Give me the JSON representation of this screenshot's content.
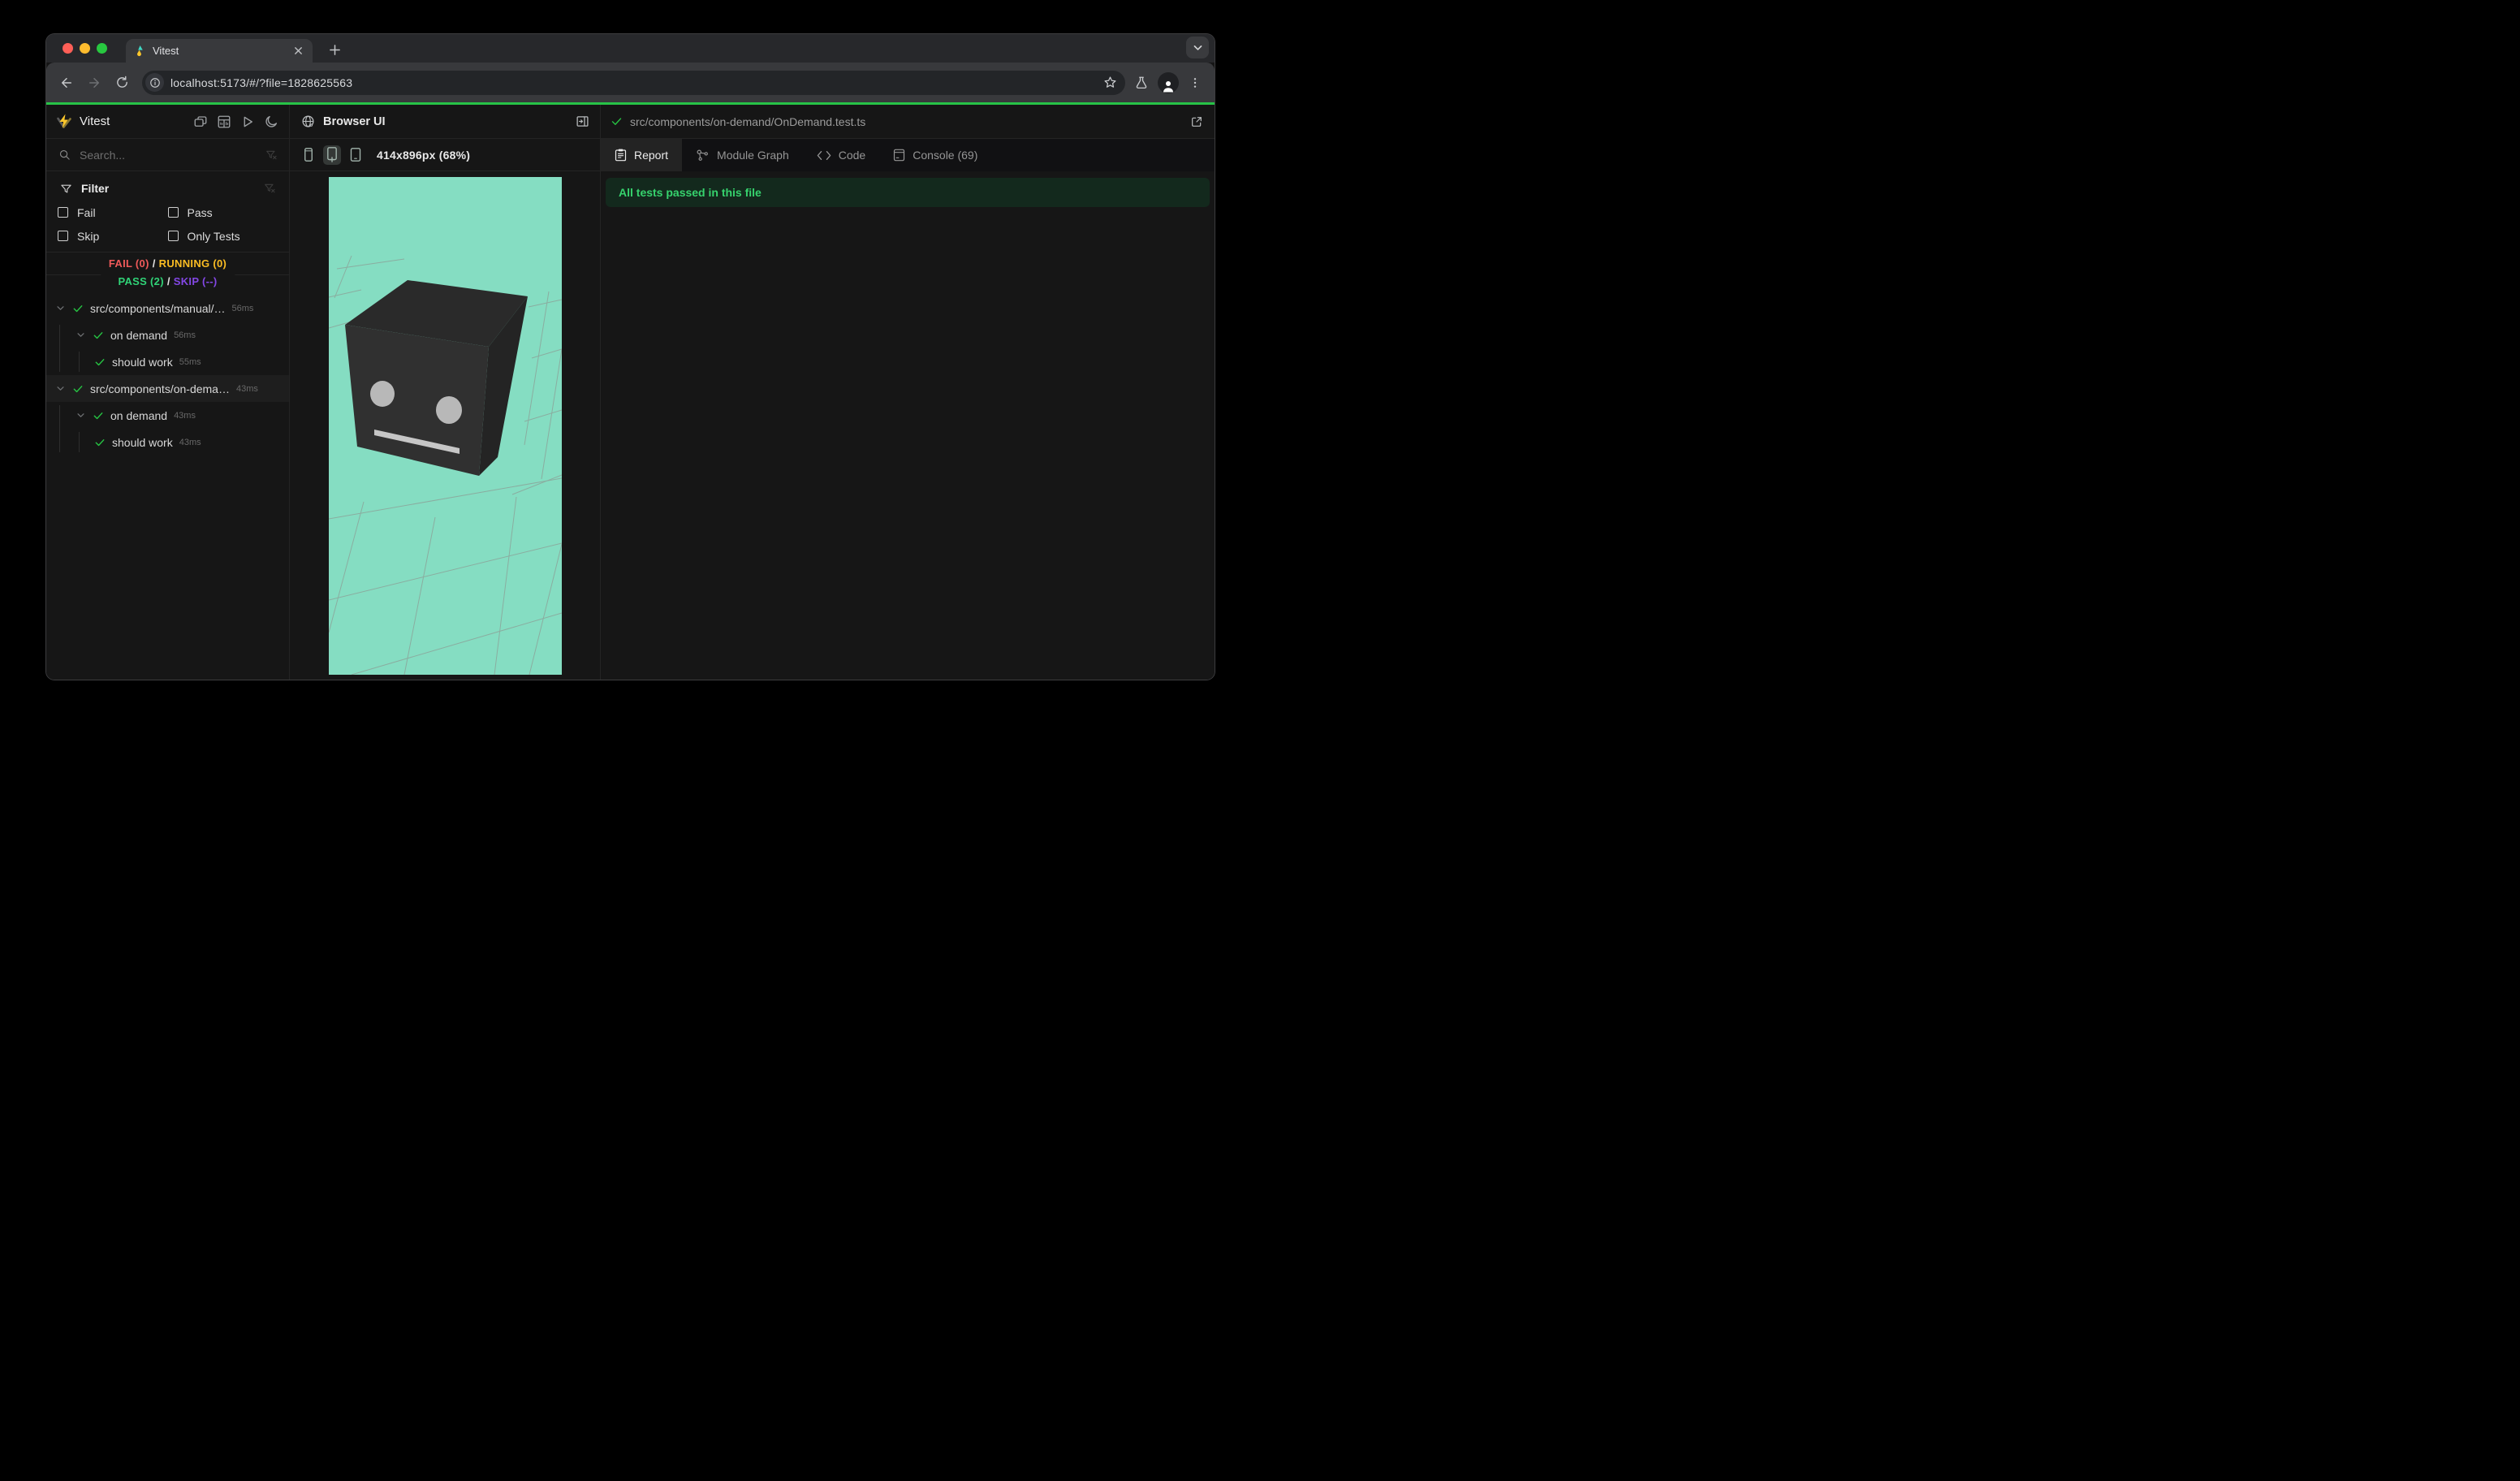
{
  "browser": {
    "tab_title": "Vitest",
    "url": "localhost:5173/#/?file=1828625563"
  },
  "sidebar": {
    "app_title": "Vitest",
    "search_placeholder": "Search...",
    "filter_title": "Filter",
    "filter_options": [
      "Fail",
      "Pass",
      "Skip",
      "Only Tests"
    ],
    "summary": {
      "fail": "FAIL (0)",
      "running": "RUNNING (0)",
      "pass": "PASS (2)",
      "skip": "SKIP (--)",
      "separator": "/"
    },
    "tree": [
      {
        "name": "src/components/manual/…",
        "time": "56ms",
        "level": 0,
        "chevron": true,
        "selected": false
      },
      {
        "name": "on demand",
        "time": "56ms",
        "level": 1,
        "chevron": true,
        "selected": false
      },
      {
        "name": "should work",
        "time": "55ms",
        "level": 2,
        "chevron": false,
        "selected": false
      },
      {
        "name": "src/components/on-dema…",
        "time": "43ms",
        "level": 0,
        "chevron": true,
        "selected": true
      },
      {
        "name": "on demand",
        "time": "43ms",
        "level": 1,
        "chevron": true,
        "selected": false
      },
      {
        "name": "should work",
        "time": "43ms",
        "level": 2,
        "chevron": false,
        "selected": false
      }
    ]
  },
  "browser_ui_panel": {
    "title": "Browser UI",
    "viewport_label": "414x896px (68%)"
  },
  "report_panel": {
    "file_path": "src/components/on-demand/OnDemand.test.ts",
    "tabs": [
      {
        "label": "Report",
        "icon": "report-icon",
        "active": true
      },
      {
        "label": "Module Graph",
        "icon": "module-graph-icon",
        "active": false
      },
      {
        "label": "Code",
        "icon": "code-icon",
        "active": false
      },
      {
        "label": "Console (69)",
        "icon": "console-icon",
        "active": false
      }
    ],
    "banner_text": "All tests passed in this file"
  },
  "colors": {
    "progress_green": "#27c347",
    "fail_red": "#f05a5a",
    "running_yellow": "#fbbd23",
    "pass_green": "#30d377",
    "skip_purple": "#8447e6",
    "viewport_mint": "#85ddc2",
    "banner_bg": "#13291d",
    "banner_text": "#36d26d"
  }
}
